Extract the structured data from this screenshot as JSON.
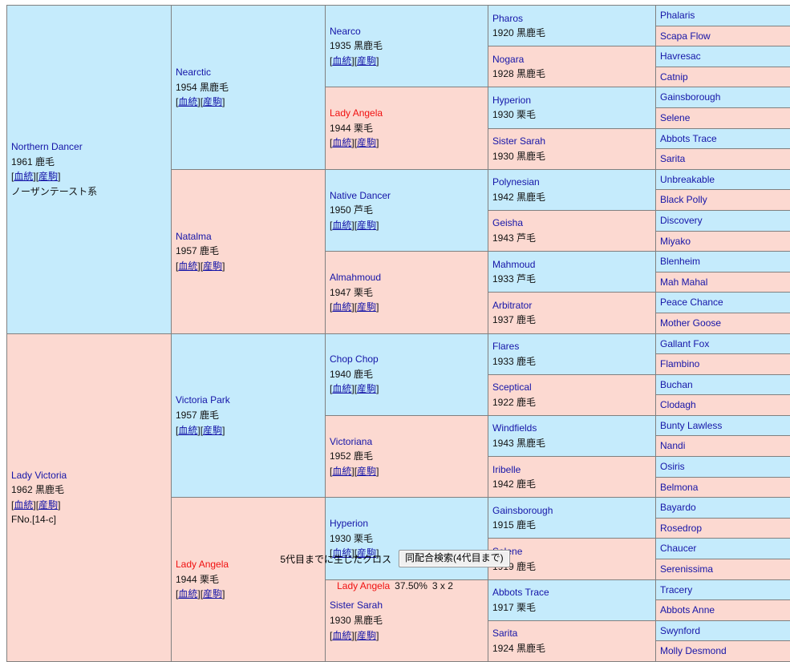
{
  "pedigree": {
    "gen1": {
      "sire": {
        "name": "Northern Dancer",
        "info": "1961 鹿毛",
        "links": [
          "血統",
          "産駒"
        ],
        "family": "ノーザンテースト系",
        "color": "blue",
        "cross": false
      },
      "dam": {
        "name": "Lady Victoria",
        "info": "1962 黒鹿毛",
        "links": [
          "血統",
          "産駒"
        ],
        "family": "FNo.[14-c]",
        "color": "pink",
        "cross": false
      }
    },
    "gen2": [
      {
        "name": "Nearctic",
        "info": "1954 黒鹿毛",
        "links": [
          "血統",
          "産駒"
        ],
        "color": "blue",
        "cross": false
      },
      {
        "name": "Natalma",
        "info": "1957 鹿毛",
        "links": [
          "血統",
          "産駒"
        ],
        "color": "pink",
        "cross": false
      },
      {
        "name": "Victoria Park",
        "info": "1957 鹿毛",
        "links": [
          "血統",
          "産駒"
        ],
        "color": "blue",
        "cross": false
      },
      {
        "name": "Lady Angela",
        "info": "1944 栗毛",
        "links": [
          "血統",
          "産駒"
        ],
        "color": "pink",
        "cross": true
      }
    ],
    "gen3": [
      {
        "name": "Nearco",
        "info": "1935 黒鹿毛",
        "links": [
          "血統",
          "産駒"
        ],
        "color": "blue",
        "cross": false
      },
      {
        "name": "Lady Angela",
        "info": "1944 栗毛",
        "links": [
          "血統",
          "産駒"
        ],
        "color": "pink",
        "cross": true
      },
      {
        "name": "Native Dancer",
        "info": "1950 芦毛",
        "links": [
          "血統",
          "産駒"
        ],
        "color": "blue",
        "cross": false
      },
      {
        "name": "Almahmoud",
        "info": "1947 栗毛",
        "links": [
          "血統",
          "産駒"
        ],
        "color": "pink",
        "cross": false
      },
      {
        "name": "Chop Chop",
        "info": "1940 鹿毛",
        "links": [
          "血統",
          "産駒"
        ],
        "color": "blue",
        "cross": false
      },
      {
        "name": "Victoriana",
        "info": "1952 鹿毛",
        "links": [
          "血統",
          "産駒"
        ],
        "color": "pink",
        "cross": false
      },
      {
        "name": "Hyperion",
        "info": "1930 栗毛",
        "links": [
          "血統",
          "産駒"
        ],
        "color": "blue",
        "cross": false
      },
      {
        "name": "Sister Sarah",
        "info": "1930 黒鹿毛",
        "links": [
          "血統",
          "産駒"
        ],
        "color": "pink",
        "cross": false
      }
    ],
    "gen4": [
      {
        "name": "Pharos",
        "info": "1920 黒鹿毛",
        "color": "blue",
        "cross": false
      },
      {
        "name": "Nogara",
        "info": "1928 黒鹿毛",
        "color": "pink",
        "cross": false
      },
      {
        "name": "Hyperion",
        "info": "1930 栗毛",
        "color": "blue",
        "cross": false
      },
      {
        "name": "Sister Sarah",
        "info": "1930 黒鹿毛",
        "color": "pink",
        "cross": false
      },
      {
        "name": "Polynesian",
        "info": "1942 黒鹿毛",
        "color": "blue",
        "cross": false
      },
      {
        "name": "Geisha",
        "info": "1943 芦毛",
        "color": "pink",
        "cross": false
      },
      {
        "name": "Mahmoud",
        "info": "1933 芦毛",
        "color": "blue",
        "cross": false
      },
      {
        "name": "Arbitrator",
        "info": "1937 鹿毛",
        "color": "pink",
        "cross": false
      },
      {
        "name": "Flares",
        "info": "1933 鹿毛",
        "color": "blue",
        "cross": false
      },
      {
        "name": "Sceptical",
        "info": "1922 鹿毛",
        "color": "pink",
        "cross": false
      },
      {
        "name": "Windfields",
        "info": "1943 黒鹿毛",
        "color": "blue",
        "cross": false
      },
      {
        "name": "Iribelle",
        "info": "1942 鹿毛",
        "color": "pink",
        "cross": false
      },
      {
        "name": "Gainsborough",
        "info": "1915 鹿毛",
        "color": "blue",
        "cross": false
      },
      {
        "name": "Selene",
        "info": "1919 鹿毛",
        "color": "pink",
        "cross": false
      },
      {
        "name": "Abbots Trace",
        "info": "1917 栗毛",
        "color": "blue",
        "cross": false
      },
      {
        "name": "Sarita",
        "info": "1924 黒鹿毛",
        "color": "pink",
        "cross": false
      }
    ],
    "gen5": [
      {
        "name": "Phalaris",
        "color": "blue"
      },
      {
        "name": "Scapa Flow",
        "color": "pink"
      },
      {
        "name": "Havresac",
        "color": "blue"
      },
      {
        "name": "Catnip",
        "color": "pink"
      },
      {
        "name": "Gainsborough",
        "color": "blue"
      },
      {
        "name": "Selene",
        "color": "pink"
      },
      {
        "name": "Abbots Trace",
        "color": "blue"
      },
      {
        "name": "Sarita",
        "color": "pink"
      },
      {
        "name": "Unbreakable",
        "color": "blue"
      },
      {
        "name": "Black Polly",
        "color": "pink"
      },
      {
        "name": "Discovery",
        "color": "blue"
      },
      {
        "name": "Miyako",
        "color": "pink"
      },
      {
        "name": "Blenheim",
        "color": "blue"
      },
      {
        "name": "Mah Mahal",
        "color": "pink"
      },
      {
        "name": "Peace Chance",
        "color": "blue"
      },
      {
        "name": "Mother Goose",
        "color": "pink"
      },
      {
        "name": "Gallant Fox",
        "color": "blue"
      },
      {
        "name": "Flambino",
        "color": "pink"
      },
      {
        "name": "Buchan",
        "color": "blue"
      },
      {
        "name": "Clodagh",
        "color": "pink"
      },
      {
        "name": "Bunty Lawless",
        "color": "blue"
      },
      {
        "name": "Nandi",
        "color": "pink"
      },
      {
        "name": "Osiris",
        "color": "blue"
      },
      {
        "name": "Belmona",
        "color": "pink"
      },
      {
        "name": "Bayardo",
        "color": "blue"
      },
      {
        "name": "Rosedrop",
        "color": "pink"
      },
      {
        "name": "Chaucer",
        "color": "blue"
      },
      {
        "name": "Serenissima",
        "color": "pink"
      },
      {
        "name": "Tracery",
        "color": "blue"
      },
      {
        "name": "Abbots Anne",
        "color": "pink"
      },
      {
        "name": "Swynford",
        "color": "blue"
      },
      {
        "name": "Molly Desmond",
        "color": "pink"
      }
    ]
  },
  "footer": {
    "cross_label": "5代目までに生じたクロス",
    "button_label": "同配合検索(4代目まで)",
    "crosses": [
      {
        "name": "Lady Angela",
        "percent": "37.50%",
        "generations": "3 x 2"
      }
    ]
  },
  "colors": {
    "cell_blue": "#c5ebfc",
    "cell_pink": "#fcd9d1",
    "link": "#1515a8",
    "cross_red": "#f01010",
    "border": "#808080"
  }
}
